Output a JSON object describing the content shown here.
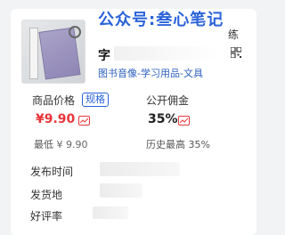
{
  "watermark": "公众号:叁心笔记",
  "product": {
    "title_start": "字",
    "title_tail_top": "练",
    "title_tail": "",
    "category": "图书音像-学习用品-文具"
  },
  "price_block": {
    "label": "商品价格",
    "tag": "规格",
    "price": "¥9.90",
    "min_label": "最低",
    "min_value": "¥ 9.90"
  },
  "commission_block": {
    "label": "公开佣金",
    "value": "35%",
    "history_label": "历史最高",
    "history_value": "35%"
  },
  "details": {
    "publish_time_label": "发布时间",
    "origin_label": "发货地",
    "rating_label": "好评率"
  },
  "colors": {
    "price_red": "#e8363a",
    "link_blue": "#2a64d8"
  }
}
